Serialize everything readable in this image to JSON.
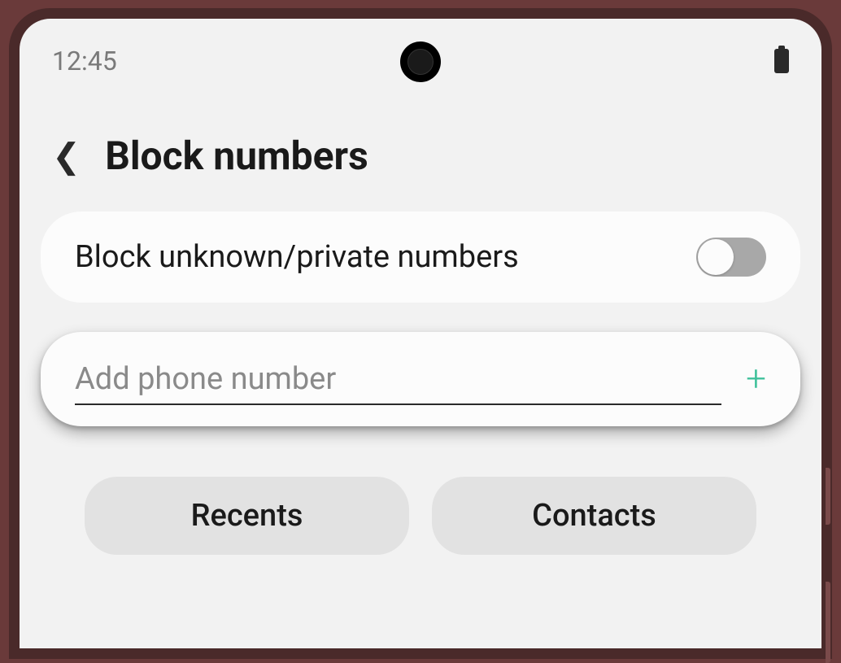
{
  "status": {
    "time": "12:45"
  },
  "header": {
    "title": "Block numbers"
  },
  "settings": {
    "block_unknown_label": "Block unknown/private numbers",
    "block_unknown_enabled": false
  },
  "input": {
    "placeholder": "Add phone number",
    "value": ""
  },
  "actions": {
    "recents_label": "Recents",
    "contacts_label": "Contacts"
  }
}
